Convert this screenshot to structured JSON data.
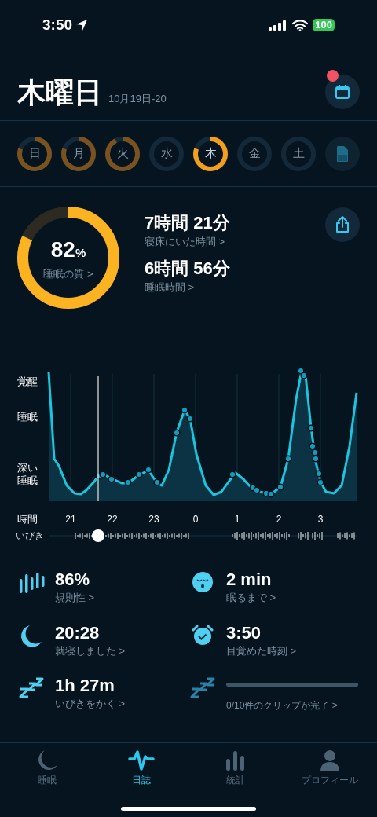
{
  "status_bar": {
    "time": "3:50",
    "battery": "100"
  },
  "header": {
    "title": "木曜日",
    "date_range": "10月19日-20",
    "notification": true
  },
  "days": [
    {
      "label": "日",
      "level": 0.8,
      "selected": false
    },
    {
      "label": "月",
      "level": 0.8,
      "selected": false
    },
    {
      "label": "火",
      "level": 0.92,
      "selected": false
    },
    {
      "label": "水",
      "level": 0,
      "selected": false
    },
    {
      "label": "木",
      "level": 0.8,
      "selected": true
    },
    {
      "label": "金",
      "level": 0,
      "selected": false
    },
    {
      "label": "土",
      "level": 0,
      "selected": false
    }
  ],
  "quality": {
    "value": "82",
    "unit": "%",
    "label": "睡眠の質 >",
    "level": 0.82
  },
  "durations": [
    {
      "value": "7時間 21分",
      "label": "寝床にいた時間 >"
    },
    {
      "value": "6時間 56分",
      "label": "睡眠時間 >"
    }
  ],
  "sleep_graph": {
    "y_labels": [
      "覚醒",
      "睡眠",
      "深い睡眠"
    ],
    "x_title": "時間",
    "x_labels": [
      "21",
      "22",
      "23",
      "0",
      "1",
      "2",
      "3"
    ],
    "snore_title": "いびき"
  },
  "stats": [
    {
      "kind": "bars",
      "value": "86%",
      "label": "規則性 >"
    },
    {
      "kind": "face",
      "value": "2 min",
      "label": "眠るまで >"
    },
    {
      "kind": "moon",
      "value": "20:28",
      "label": "就寝しました >"
    },
    {
      "kind": "alarm",
      "value": "3:50",
      "label": "目覚めた時刻 >"
    },
    {
      "kind": "snore",
      "value": "1h 27m",
      "label": "いびきをかく >"
    },
    {
      "kind": "clips",
      "label": "0/10件のクリップが完了 >"
    }
  ],
  "tabs": [
    {
      "label": "睡眠",
      "selected": false
    },
    {
      "label": "日誌",
      "selected": true
    },
    {
      "label": "統計",
      "selected": false
    },
    {
      "label": "プロフィール",
      "selected": false
    }
  ]
}
